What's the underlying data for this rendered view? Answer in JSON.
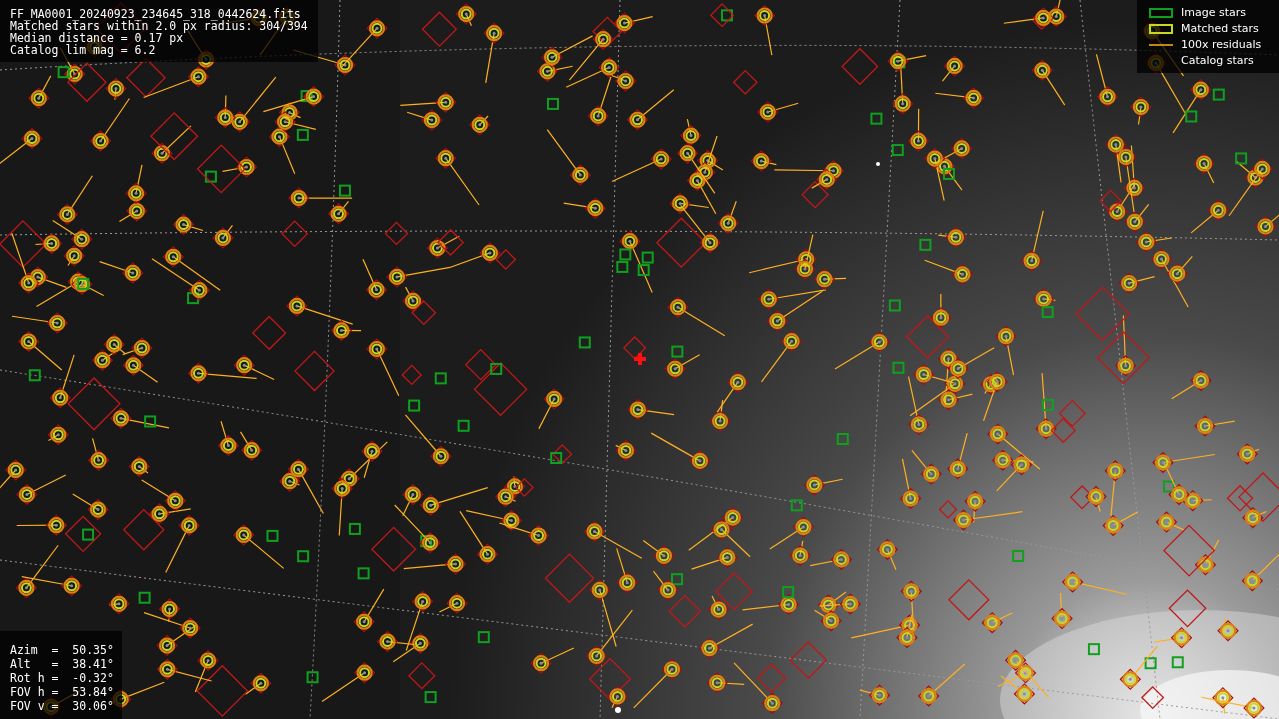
{
  "info_top": {
    "lines": [
      "FF_MA0001_20240923_234645_318_0442624.fits",
      "Matched stars within 2.0 px radius: 304/394",
      "Median distance = 0.17 px",
      "Catalog lim mag = 6.2"
    ]
  },
  "legend": [
    {
      "kind": "image",
      "label": "Image stars"
    },
    {
      "kind": "matched",
      "label": "Matched stars"
    },
    {
      "kind": "residual",
      "label": "100x residuals"
    },
    {
      "kind": "catalog",
      "label": "Catalog stars"
    }
  ],
  "info_bottom": {
    "lines": [
      "Azim  =  50.35°",
      "Alt   =  38.41°",
      "Rot h =  -0.32°",
      "FOV h =  53.84°",
      "FOV v =  30.06°"
    ]
  }
}
